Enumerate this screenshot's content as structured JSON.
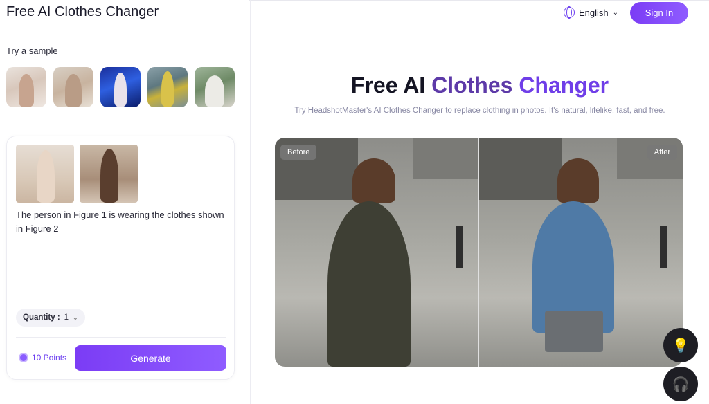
{
  "header": {
    "app_title": "Free AI Clothes Changer",
    "language": "English",
    "sign_in": "Sign In"
  },
  "samples": {
    "label": "Try a sample",
    "items": [
      "sample-1",
      "sample-2",
      "sample-3",
      "sample-4",
      "sample-5"
    ]
  },
  "editor": {
    "prompt": "The person in Figure 1 is wearing the clothes shown in Figure 2",
    "quantity_label": "Quantity :",
    "quantity_value": "1",
    "points": "10 Points",
    "generate": "Generate"
  },
  "hero": {
    "title_part1": "Free AI ",
    "title_part2": "Clothes ",
    "title_part3": "Changer",
    "subtitle": "Try HeadshotMaster's AI Clothes Changer to replace clothing in photos. It's natural, lifelike, fast, and free."
  },
  "comparison": {
    "before_label": "Before",
    "after_label": "After"
  },
  "fabs": {
    "tips_icon": "lightbulb-icon",
    "support_icon": "headset-icon"
  },
  "colors": {
    "accent": "#7b3cf5",
    "title_purple": "#6f3ee8"
  }
}
